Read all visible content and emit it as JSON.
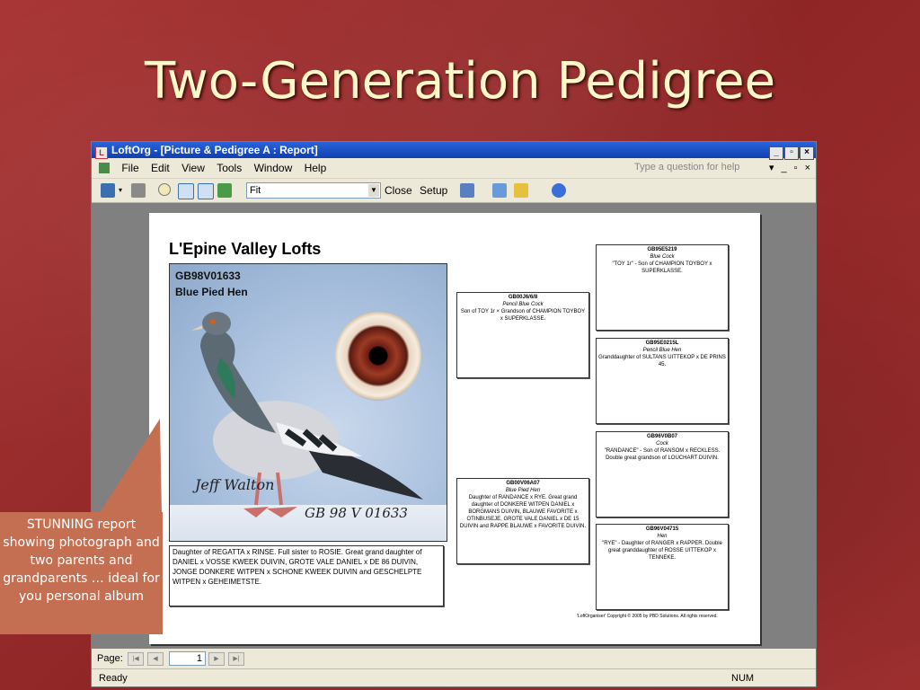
{
  "slide": {
    "title": "Two-Generation Pedigree"
  },
  "window": {
    "title": "LoftOrg - [Picture & Pedigree A : Report]",
    "controls": [
      "_",
      "▫",
      "×"
    ]
  },
  "menu": {
    "items": [
      "File",
      "Edit",
      "View",
      "Tools",
      "Window",
      "Help"
    ],
    "help_placeholder": "Type a question for help"
  },
  "toolbar": {
    "zoom_value": "Fit",
    "close_label": "Close",
    "setup_label": "Setup"
  },
  "report": {
    "title": "L'Epine Valley Lofts",
    "ring": "GB98V01633",
    "color": "Blue Pied Hen",
    "photo_signature": "Jeff Walton",
    "photo_number": "GB 98 V 01633",
    "description": "Daughter of REGATTA x RINSE. Full sister to ROSIE. Great grand daughter of DANIEL x VOSSE KWEEK DUIVIN, GROTE VALE DANIEL x DE 86 DUIVIN, JONGE DONKERE WITPEN x SCHONE KWEEK DUIVIN and GESCHELPTE WITPEN x GEHEIMETSTE.",
    "sire": {
      "ring": "GB00J6/6/8",
      "color": "Pencil Blue Cock",
      "text": "Son of TOY 1r × Grandson of CHAMPION TOYBOY x SUPERKLASSE."
    },
    "dam": {
      "ring": "GB00V06A07",
      "color": "Blue Pied Hen",
      "text": "Daughter of RANDANCE x RYE. Great grand daughter of DONKERE WITPEN DANIEL x BORGMANS DUIVIN, BLAUWE FAVORITE x OTINBUSEJE, GROTE VALE DANIEL x DE 15 DUIVIN and RAPPE BLAUWE x FAVORITE DUIVIN."
    },
    "gp1": {
      "ring": "GB95E5219",
      "color": "Blue Cock",
      "text": "\"TOY 1r\" - Son of CHAMPION TOYBOY x SUPERKLASSE."
    },
    "gp2": {
      "ring": "GB95E0215L",
      "color": "Pencil Blue Hen",
      "text": "Granddaughter of SULTANS UITTEKOP x DE PRINS 45."
    },
    "gp3": {
      "ring": "GB96V0B07",
      "color": "Cock",
      "text": "\"RANDANCE\" - Son of RANSOM x RECKLESS. Double great grandson of LOUCHART DUIVIN."
    },
    "gp4": {
      "ring": "GB96V04715",
      "color": "Hen",
      "text": "\"RYE\" - Daughter of RANGER x RAPPER. Double great granddaughter of ROSSE UITTEKOP x TENNEKE."
    },
    "copyright": "'LoftOrganiser' Copyright © 2005 by PBD Solutions. All rights reserved."
  },
  "navigation": {
    "label": "Page:",
    "page": "1"
  },
  "status": {
    "text": "Ready",
    "num": "NUM"
  },
  "callout": {
    "text": "STUNNING report showing photograph and two parents and grandparents … ideal for you personal album"
  }
}
